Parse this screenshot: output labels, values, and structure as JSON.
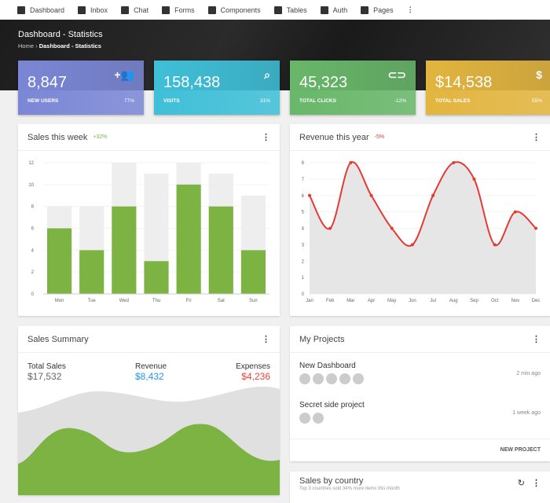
{
  "nav": [
    {
      "label": "Dashboard",
      "icon": "dashboard-icon"
    },
    {
      "label": "Inbox",
      "icon": "mail-icon"
    },
    {
      "label": "Chat",
      "icon": "chat-icon"
    },
    {
      "label": "Forms",
      "icon": "clipboard-icon"
    },
    {
      "label": "Components",
      "icon": "layers-icon"
    },
    {
      "label": "Tables",
      "icon": "list-icon"
    },
    {
      "label": "Auth",
      "icon": "account-icon"
    },
    {
      "label": "Pages",
      "icon": "pages-icon"
    }
  ],
  "header": {
    "title": "Dashboard - Statistics",
    "breadcrumb": [
      "Home",
      "Dashboard - Statistics"
    ]
  },
  "stats": [
    {
      "value": "8,847",
      "label": "NEW USERS",
      "change": "77%",
      "icon": "group-add-icon",
      "color": "#7b87d6"
    },
    {
      "value": "158,438",
      "label": "VISITS",
      "change": "31%",
      "icon": "search-icon",
      "color": "#3fbfd8"
    },
    {
      "value": "45,323",
      "label": "TOTAL CLICKS",
      "change": "-12%",
      "icon": "link-icon",
      "color": "#68b76a"
    },
    {
      "value": "$14,538",
      "label": "TOTAL SALES",
      "change": "55%",
      "icon": "dollar-icon",
      "color": "#e3b53f"
    }
  ],
  "sales_week": {
    "title": "Sales this week",
    "badge": "+32%",
    "badge_color": "#7cb342"
  },
  "revenue": {
    "title": "Revenue this year",
    "badge": "-5%",
    "badge_color": "#e53935"
  },
  "chart_data": [
    {
      "type": "bar",
      "categories": [
        "Mon",
        "Tue",
        "Wed",
        "Thu",
        "Fri",
        "Sat",
        "Sun"
      ],
      "series": [
        {
          "values": [
            6,
            4,
            8,
            3,
            10,
            8,
            4
          ]
        },
        {
          "values": [
            8,
            8,
            12,
            11,
            12,
            11,
            9
          ]
        }
      ],
      "ylim": [
        0,
        12
      ],
      "yticks": [
        0,
        2,
        4,
        6,
        8,
        10,
        12
      ],
      "colors": [
        "#7cb342",
        "#eeeeee"
      ],
      "grid": true
    },
    {
      "type": "area",
      "categories": [
        "Jan",
        "Feb",
        "Mar",
        "Apr",
        "May",
        "Jun",
        "Jul",
        "Aug",
        "Sep",
        "Oct",
        "Nov",
        "Dec"
      ],
      "values": [
        6,
        4,
        8,
        6,
        4,
        3,
        6,
        8,
        7,
        3,
        5,
        4
      ],
      "ylim": [
        0,
        8
      ],
      "yticks": [
        0,
        1,
        2,
        3,
        4,
        5,
        6,
        7,
        8
      ],
      "line_color": "#e53935",
      "fill_color": "#e6e6e6",
      "grid": true
    }
  ],
  "summary": {
    "title": "Sales Summary",
    "items": [
      {
        "label": "Total Sales",
        "value": "$17,532",
        "color": "#666"
      },
      {
        "label": "Revenue",
        "value": "$8,432",
        "color": "#2196f3"
      },
      {
        "label": "Expenses",
        "value": "$4,236",
        "color": "#f44336"
      }
    ]
  },
  "projects": {
    "title": "My Projects",
    "items": [
      {
        "name": "New Dashboard",
        "time": "2 min ago",
        "members": 5
      },
      {
        "name": "Secret side project",
        "time": "1 week ago",
        "members": 2
      }
    ],
    "action": "NEW PROJECT"
  },
  "country": {
    "title": "Sales by country",
    "subtitle": "Top 3 countries sold 34% more items this month"
  }
}
